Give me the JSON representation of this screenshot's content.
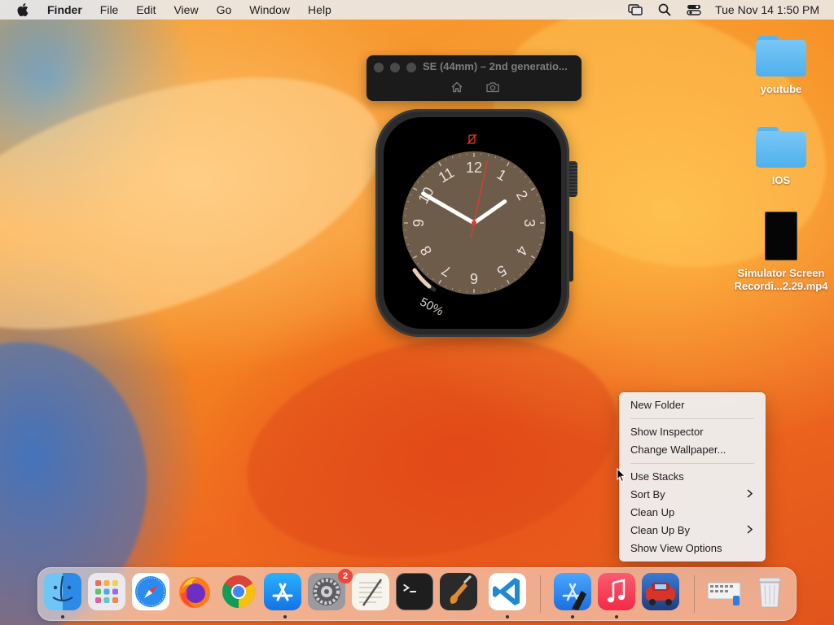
{
  "menubar": {
    "app_name": "Finder",
    "menus": [
      "File",
      "Edit",
      "View",
      "Go",
      "Window",
      "Help"
    ],
    "clock": "Tue Nov 14  1:50 PM",
    "status_icons": [
      "screen-mirroring-icon",
      "spotlight-search-icon",
      "control-center-icon"
    ]
  },
  "simulator": {
    "title": "SE (44mm) – 2nd generatio...",
    "buttons": [
      "home-icon",
      "screenshot-camera-icon"
    ]
  },
  "watch": {
    "numerals": [
      "12",
      "1",
      "2",
      "3",
      "4",
      "5",
      "6",
      "7",
      "8",
      "9",
      "10",
      "11"
    ],
    "battery_text": "50%",
    "battery_level": 0.5,
    "time_shown": "1:50"
  },
  "desktop_icons": [
    {
      "label": "youtube",
      "kind": "folder"
    },
    {
      "label": "IOS",
      "kind": "folder"
    },
    {
      "label": "Simulator Screen Recordi...2.29.mp4",
      "kind": "video"
    }
  ],
  "context_menu": {
    "groups": [
      [
        {
          "label": "New Folder"
        }
      ],
      [
        {
          "label": "Show Inspector"
        },
        {
          "label": "Change Wallpaper..."
        }
      ],
      [
        {
          "label": "Use Stacks"
        },
        {
          "label": "Sort By",
          "submenu": true
        },
        {
          "label": "Clean Up"
        },
        {
          "label": "Clean Up By",
          "submenu": true
        },
        {
          "label": "Show View Options"
        }
      ]
    ],
    "submenu_glyph": ">"
  },
  "dock": {
    "apps": [
      {
        "name": "finder-icon",
        "running": true
      },
      {
        "name": "launchpad-icon",
        "running": false
      },
      {
        "name": "safari-icon",
        "running": false
      },
      {
        "name": "firefox-icon",
        "running": false
      },
      {
        "name": "chrome-icon",
        "running": false
      },
      {
        "name": "app-store-icon",
        "running": true
      },
      {
        "name": "system-settings-icon",
        "running": false,
        "badge": "2"
      },
      {
        "name": "textedit-icon",
        "running": false
      },
      {
        "name": "terminal-icon",
        "running": false
      },
      {
        "name": "garageband-icon",
        "running": false
      },
      {
        "name": "vscode-icon",
        "running": true
      },
      {
        "name": "xcode-simulator-icon",
        "running": true
      },
      {
        "name": "music-icon",
        "running": true
      },
      {
        "name": "game-app-icon",
        "running": false
      },
      {
        "name": "screenshot-keyboard-icon",
        "running": false
      },
      {
        "name": "trash-icon",
        "running": false
      }
    ]
  }
}
